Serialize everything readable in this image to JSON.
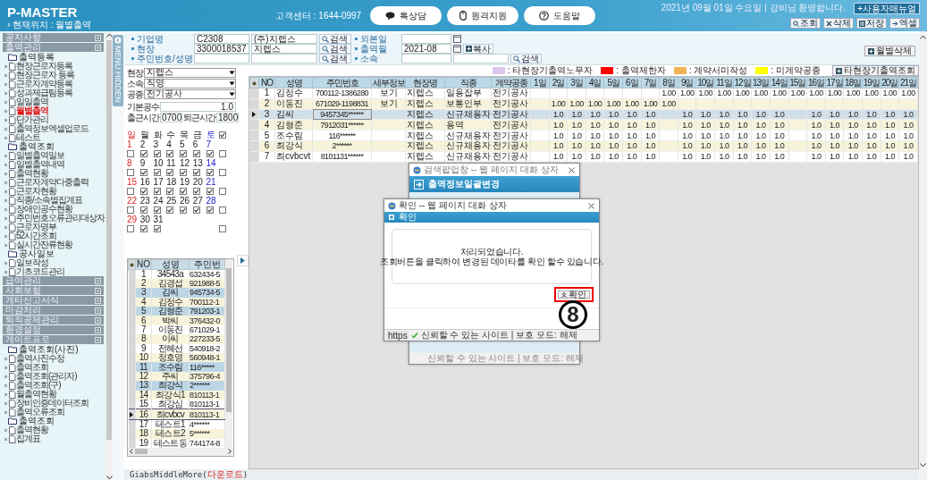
{
  "header": {
    "logo": "P-MASTER",
    "location": "› 현재위치 : 월별출역",
    "support": "고객센터 : 1644-0997",
    "buttons": [
      {
        "label": "톡상담"
      },
      {
        "label": "원격지원"
      },
      {
        "label": "도움말"
      }
    ],
    "date_user": "2021년 09월 01일 수요일 | 강비님 환영합니다.",
    "manual_button": "+사용자매뉴얼",
    "toolbar": [
      {
        "label": "조회"
      },
      {
        "label": "삭제"
      },
      {
        "label": "저장"
      },
      {
        "label": "엑셀"
      }
    ]
  },
  "sidebar": {
    "sections": [
      {
        "label": "공지사항"
      },
      {
        "label": "출역관리",
        "children": [
          {
            "label": "출역등록",
            "children": [
              {
                "label": "현장근로자등록",
                "selected": false
              },
              {
                "label": "현장근로자 등록",
                "selected": false
              },
              {
                "label": "근로자계약등록",
                "selected": false
              },
              {
                "label": "성과제급팀등록",
                "selected": false
              },
              {
                "label": "일일출역",
                "selected": false
              },
              {
                "label": "월별출역",
                "selected": true
              },
              {
                "label": "단가관리",
                "selected": false
              },
              {
                "label": "출역정보엑셀업로드",
                "selected": false
              },
              {
                "label": "테스트",
                "selected": false
              }
            ]
          },
          {
            "label": "출역조회",
            "children": [
              {
                "label": "일별출역일보",
                "selected": false
              },
              {
                "label": "일별출역내역",
                "selected": false
              },
              {
                "label": "출역현황",
                "selected": false
              },
              {
                "label": "근로자계약다중출력",
                "selected": false
              },
              {
                "label": "근로자현황",
                "selected": false
              },
              {
                "label": "직종/소속별집계표",
                "selected": false
              },
              {
                "label": "장애인공수현황",
                "selected": false
              },
              {
                "label": "주민번호오류관리대상자",
                "selected": false
              },
              {
                "label": "근로자명부",
                "selected": false
              },
              {
                "label": "52시간조회",
                "selected": false
              },
              {
                "label": "실시간잔류현황",
                "selected": false
              }
            ]
          },
          {
            "label": "공사일보",
            "children": [
              {
                "label": "일보작성",
                "selected": false
              },
              {
                "label": "기초코드관리",
                "selected": false
              }
            ]
          }
        ]
      },
      {
        "label": "급여관리"
      },
      {
        "label": "사회보험"
      },
      {
        "label": "게타신고서식"
      },
      {
        "label": "마감처리"
      },
      {
        "label": "퇴직공제관리"
      },
      {
        "label": "환경설정"
      },
      {
        "label": "게이트프로",
        "children": [
          {
            "label": "출역조회(사진)",
            "children": [
              {
                "label": "출역사진수정",
                "selected": false
              },
              {
                "label": "출역조회",
                "selected": false
              },
              {
                "label": "출역조회(관리자)",
                "selected": false
              },
              {
                "label": "출역조회(구)",
                "selected": false
              },
              {
                "label": "월출역현황",
                "selected": false
              },
              {
                "label": "장비인증데이터조회",
                "selected": false
              },
              {
                "label": "출역오류조회",
                "selected": false
              }
            ]
          },
          {
            "label": "출역조회",
            "children": [
              {
                "label": "출역현황",
                "selected": false
              },
              {
                "label": "집계표",
                "selected": false
              }
            ]
          }
        ]
      }
    ]
  },
  "menu_toggle": "MENU HIDDEN",
  "filters": {
    "left": [
      {
        "label": "기업명",
        "code": "C2308",
        "name": "(주)지렙스",
        "button": "검색"
      },
      {
        "label": "현장",
        "code": "3300018537",
        "name": "지렙스",
        "button": "검색"
      },
      {
        "label": "주민번호/성명",
        "button": "검색"
      }
    ],
    "right": [
      {
        "label": "외본일",
        "kind": "date"
      },
      {
        "label": "출역월",
        "kind": "date",
        "value": "2021-08",
        "button": "복사"
      },
      {
        "label": "소속",
        "kind": "lookup",
        "button": "검색"
      }
    ]
  },
  "delete_button": "월별삭제",
  "legend": [
    {
      "label": ": 타현장기출역노무자",
      "color": "#dcc6ee"
    },
    {
      "label": ": 출역제한자",
      "color": "#ff0000"
    },
    {
      "label": ": 계약서미작성",
      "color": "#f0b456"
    },
    {
      "label": ": 미계약공종",
      "color": "#ffff00"
    }
  ],
  "legend_button": "타현장기출역조회",
  "options": {
    "selects": [
      {
        "label": "현장",
        "value": "지렙스"
      },
      {
        "label": "소속",
        "value": "직영"
      },
      {
        "label": "공종",
        "value": "전기공사"
      }
    ],
    "base": {
      "label": "기본공수",
      "value": "1.0"
    },
    "times": [
      {
        "label": "출근시간",
        "value": "0700"
      },
      {
        "label": "퇴근시간",
        "value": "1800"
      }
    ]
  },
  "calendar": {
    "weekdays": [
      "일",
      "월",
      "화",
      "수",
      "목",
      "금",
      "토"
    ],
    "all_checked": true,
    "weeks": [
      {
        "checked": false,
        "days": [
          {
            "date": "1",
            "checked": false
          },
          {
            "date": "2",
            "checked": true
          },
          {
            "date": "3",
            "checked": true
          },
          {
            "date": "4",
            "checked": true
          },
          {
            "date": "5",
            "checked": true
          },
          {
            "date": "6",
            "checked": true
          },
          {
            "date": "7",
            "checked": true
          }
        ]
      },
      {
        "checked": false,
        "days": [
          {
            "date": "8",
            "checked": false
          },
          {
            "date": "9",
            "checked": true
          },
          {
            "date": "10",
            "checked": true
          },
          {
            "date": "11",
            "checked": true
          },
          {
            "date": "12",
            "checked": true
          },
          {
            "date": "13",
            "checked": true
          },
          {
            "date": "14",
            "checked": true
          }
        ]
      },
      {
        "checked": false,
        "days": [
          {
            "date": "15",
            "checked": false
          },
          {
            "date": "16",
            "checked": true
          },
          {
            "date": "17",
            "checked": true
          },
          {
            "date": "18",
            "checked": true
          },
          {
            "date": "19",
            "checked": true
          },
          {
            "date": "20",
            "checked": true
          },
          {
            "date": "21",
            "checked": true
          }
        ]
      },
      {
        "checked": false,
        "days": [
          {
            "date": "22",
            "checked": false
          },
          {
            "date": "23",
            "checked": true
          },
          {
            "date": "24",
            "checked": true
          },
          {
            "date": "25",
            "checked": true
          },
          {
            "date": "26",
            "checked": true
          },
          {
            "date": "27",
            "checked": true
          },
          {
            "date": "28",
            "checked": true
          }
        ]
      },
      {
        "checked": false,
        "days": [
          {
            "date": "29",
            "checked": false
          },
          {
            "date": "30",
            "checked": true
          },
          {
            "date": "31",
            "checked": true
          }
        ]
      }
    ]
  },
  "worker_list": {
    "columns": [
      "NO",
      "성명",
      "주민번"
    ],
    "rows": [
      {
        "no": "1",
        "name": "34543a",
        "id": "632434-5",
        "highlighted": false,
        "selected": false
      },
      {
        "no": "2",
        "name": "김경섭",
        "id": "921988-5",
        "highlighted": false,
        "selected": false
      },
      {
        "no": "3",
        "name": "김씨",
        "id": "945734-5",
        "highlighted": true,
        "selected": false
      },
      {
        "no": "4",
        "name": "김정수",
        "id": "700112-1",
        "highlighted": false,
        "selected": false
      },
      {
        "no": "5",
        "name": "김형준",
        "id": "791203-1",
        "highlighted": true,
        "selected": false
      },
      {
        "no": "6",
        "name": "박씨",
        "id": "376432-0",
        "highlighted": false,
        "selected": false
      },
      {
        "no": "7",
        "name": "이동진",
        "id": "671029-1",
        "highlighted": false,
        "selected": false
      },
      {
        "no": "8",
        "name": "이씨",
        "id": "227233-5",
        "highlighted": false,
        "selected": false
      },
      {
        "no": "9",
        "name": "전혜선",
        "id": "540918-2",
        "highlighted": false,
        "selected": false
      },
      {
        "no": "10",
        "name": "정호영",
        "id": "560948-1",
        "highlighted": false,
        "selected": false
      },
      {
        "no": "11",
        "name": "조수림",
        "id": "116*****",
        "highlighted": true,
        "selected": false
      },
      {
        "no": "12",
        "name": "주씨",
        "id": "375796-4",
        "highlighted": false,
        "selected": false
      },
      {
        "no": "13",
        "name": "최강식",
        "id": "2******",
        "highlighted": true,
        "selected": false
      },
      {
        "no": "14",
        "name": "최강식1",
        "id": "810113-1",
        "highlighted": false,
        "selected": false
      },
      {
        "no": "15",
        "name": "최강심",
        "id": "810113-1",
        "highlighted": false,
        "selected": false
      },
      {
        "no": "16",
        "name": "최cvbcv",
        "id": "810113-1",
        "highlighted": false,
        "selected": true
      },
      {
        "no": "17",
        "name": "테스트1",
        "id": "4******",
        "highlighted": false,
        "selected": false
      },
      {
        "no": "18",
        "name": "테스트2",
        "id": "5******",
        "highlighted": false,
        "selected": false
      },
      {
        "no": "19",
        "name": "테스트동",
        "id": "744174-8",
        "highlighted": false,
        "selected": false
      }
    ]
  },
  "table": {
    "columns": [
      "NO",
      "성명",
      "주민번호",
      "세부정보",
      "현장명",
      "직종",
      "계약공종",
      "1일",
      "2일",
      "3일",
      "4일",
      "5일",
      "6일",
      "7일",
      "8일",
      "9일",
      "10일",
      "11일",
      "12일",
      "13일",
      "14일",
      "15일",
      "16일",
      "17일",
      "18일",
      "19일",
      "20일",
      "21일"
    ],
    "rows": [
      {
        "no": "1",
        "name": "김정수",
        "id": "700112-1386280",
        "detail": "보기",
        "site": "지렙스",
        "job": "일용잡부",
        "trade": "전기공사",
        "selected": false,
        "days": [
          {
            "kind": "blank"
          },
          {
            "kind": "blank"
          },
          {
            "kind": "blank"
          },
          {
            "kind": "blank"
          },
          {
            "kind": "blank"
          },
          {
            "kind": "blank"
          },
          {
            "kind": "blank"
          },
          {
            "kind": "value",
            "value": "1.00"
          },
          {
            "kind": "value",
            "value": "1.00"
          },
          {
            "kind": "value",
            "value": "1.00"
          },
          {
            "kind": "value",
            "value": "1.00"
          },
          {
            "kind": "value",
            "value": "1.00"
          },
          {
            "kind": "value",
            "value": "1.00"
          },
          {
            "kind": "value",
            "value": "1.00"
          },
          {
            "kind": "value",
            "value": "1.00"
          },
          {
            "kind": "value",
            "value": "1.00"
          },
          {
            "kind": "value",
            "value": "1.00"
          },
          {
            "kind": "value",
            "value": "1.00"
          },
          {
            "kind": "value",
            "value": "1.00"
          },
          {
            "kind": "value",
            "value": "1.00"
          },
          {
            "kind": "value",
            "value": "1.00"
          }
        ]
      },
      {
        "no": "2",
        "name": "이동진",
        "id": "671029-1198831",
        "detail": "보기",
        "site": "지렙스",
        "job": "보통인부",
        "trade": "전기공사",
        "selected": false,
        "days": [
          {
            "kind": "blank"
          },
          {
            "kind": "value",
            "value": "1.00"
          },
          {
            "kind": "value",
            "value": "1.00"
          },
          {
            "kind": "value",
            "value": "1.00"
          },
          {
            "kind": "value",
            "value": "1.00"
          },
          {
            "kind": "value",
            "value": "1.00"
          },
          {
            "kind": "value",
            "value": "1.00"
          },
          {
            "kind": "value",
            "value": "1.00"
          },
          {
            "kind": "blank"
          },
          {
            "kind": "blank"
          },
          {
            "kind": "blank"
          },
          {
            "kind": "blank"
          },
          {
            "kind": "blank"
          },
          {
            "kind": "blank"
          },
          {
            "kind": "blank"
          },
          {
            "kind": "blank"
          },
          {
            "kind": "blank"
          },
          {
            "kind": "blank"
          },
          {
            "kind": "blank"
          },
          {
            "kind": "blank"
          },
          {
            "kind": "blank"
          }
        ]
      },
      {
        "no": "3",
        "name": "김씨",
        "id": "9457345******",
        "site": "지렙스",
        "job": "신규채용자",
        "trade": "전기공사",
        "selected": true,
        "days": [
          {
            "kind": "blank"
          },
          {
            "kind": "value",
            "value": "1.0"
          },
          {
            "kind": "value",
            "value": "1.0"
          },
          {
            "kind": "value",
            "value": "1.0"
          },
          {
            "kind": "value",
            "value": "1.0"
          },
          {
            "kind": "value",
            "value": "1.0"
          },
          {
            "kind": "value",
            "value": "1.0"
          },
          {
            "kind": "blank"
          },
          {
            "kind": "value",
            "value": "1.0"
          },
          {
            "kind": "value",
            "value": "1.0"
          },
          {
            "kind": "value",
            "value": "1.0"
          },
          {
            "kind": "value",
            "value": "1.0"
          },
          {
            "kind": "value",
            "value": "1.0"
          },
          {
            "kind": "value",
            "value": "1.0"
          },
          {
            "kind": "blank"
          },
          {
            "kind": "value",
            "value": "1.0"
          },
          {
            "kind": "value",
            "value": "1.0"
          },
          {
            "kind": "value",
            "value": "1.0"
          },
          {
            "kind": "value",
            "value": "1.0"
          },
          {
            "kind": "value",
            "value": "1.0"
          },
          {
            "kind": "value",
            "value": "1.0"
          }
        ]
      },
      {
        "no": "4",
        "name": "김형준",
        "id": "7912031******",
        "site": "지렙스",
        "job": "용역",
        "trade": "전기공사",
        "selected": false,
        "days": [
          {
            "kind": "blank"
          },
          {
            "kind": "value",
            "value": "1.0"
          },
          {
            "kind": "value",
            "value": "1.0"
          },
          {
            "kind": "value",
            "value": "1.0"
          },
          {
            "kind": "value",
            "value": "1.0"
          },
          {
            "kind": "value",
            "value": "1.0"
          },
          {
            "kind": "value",
            "value": "1.0"
          },
          {
            "kind": "blank"
          },
          {
            "kind": "value",
            "value": "1.0"
          },
          {
            "kind": "value",
            "value": "1.0"
          },
          {
            "kind": "value",
            "value": "1.0"
          },
          {
            "kind": "value",
            "value": "1.0"
          },
          {
            "kind": "value",
            "value": "1.0"
          },
          {
            "kind": "value",
            "value": "1.0"
          },
          {
            "kind": "blank"
          },
          {
            "kind": "value",
            "value": "1.0"
          },
          {
            "kind": "value",
            "value": "1.0"
          },
          {
            "kind": "value",
            "value": "1.0"
          },
          {
            "kind": "value",
            "value": "1.0"
          },
          {
            "kind": "value",
            "value": "1.0"
          },
          {
            "kind": "value",
            "value": "1.0"
          }
        ]
      },
      {
        "no": "5",
        "name": "조수림",
        "id": "116******",
        "site": "지렙스",
        "job": "신규채용자",
        "trade": "전기공사",
        "selected": false,
        "days": [
          {
            "kind": "blank"
          },
          {
            "kind": "value",
            "value": "1.0"
          },
          {
            "kind": "value",
            "value": "1.0"
          },
          {
            "kind": "value",
            "value": "1.0"
          },
          {
            "kind": "value",
            "value": "1.0"
          },
          {
            "kind": "value",
            "value": "1.0"
          },
          {
            "kind": "value",
            "value": "1.0"
          },
          {
            "kind": "blank"
          },
          {
            "kind": "value",
            "value": "1.0"
          },
          {
            "kind": "value",
            "value": "1.0"
          },
          {
            "kind": "value",
            "value": "1.0"
          },
          {
            "kind": "value",
            "value": "1.0"
          },
          {
            "kind": "value",
            "value": "1.0"
          },
          {
            "kind": "value",
            "value": "1.0"
          },
          {
            "kind": "blank"
          },
          {
            "kind": "value",
            "value": "1.0"
          },
          {
            "kind": "value",
            "value": "1.0"
          },
          {
            "kind": "value",
            "value": "1.0"
          },
          {
            "kind": "value",
            "value": "1.0"
          },
          {
            "kind": "value",
            "value": "1.0"
          },
          {
            "kind": "value",
            "value": "1.0"
          }
        ]
      },
      {
        "no": "6",
        "name": "최강식",
        "id": "2******",
        "site": "지렙스",
        "job": "신규채용자",
        "trade": "전기공사",
        "selected": false,
        "days": [
          {
            "kind": "blank"
          },
          {
            "kind": "value",
            "value": "1.0"
          },
          {
            "kind": "value",
            "value": "1.0"
          },
          {
            "kind": "value",
            "value": "1.0"
          },
          {
            "kind": "value",
            "value": "1.0"
          },
          {
            "kind": "value",
            "value": "1.0"
          },
          {
            "kind": "value",
            "value": "1.0"
          },
          {
            "kind": "blank"
          },
          {
            "kind": "value",
            "value": "1.0"
          },
          {
            "kind": "value",
            "value": "1.0"
          },
          {
            "kind": "value",
            "value": "1.0"
          },
          {
            "kind": "value",
            "value": "1.0"
          },
          {
            "kind": "value",
            "value": "1.0"
          },
          {
            "kind": "value",
            "value": "1.0"
          },
          {
            "kind": "blank"
          },
          {
            "kind": "value",
            "value": "1.0"
          },
          {
            "kind": "value",
            "value": "1.0"
          },
          {
            "kind": "value",
            "value": "1.0"
          },
          {
            "kind": "value",
            "value": "1.0"
          },
          {
            "kind": "value",
            "value": "1.0"
          },
          {
            "kind": "value",
            "value": "1.0"
          }
        ]
      },
      {
        "no": "7",
        "name": "최cvbcvt",
        "id": "8101131******",
        "site": "지렙스",
        "job": "신규채용자",
        "trade": "전기공사",
        "selected": false,
        "days": [
          {
            "kind": "blank"
          },
          {
            "kind": "value",
            "value": "1.0"
          },
          {
            "kind": "value",
            "value": "1.0"
          },
          {
            "kind": "value",
            "value": "1.0"
          },
          {
            "kind": "value",
            "value": "1.0"
          },
          {
            "kind": "value",
            "value": "1.0"
          },
          {
            "kind": "value",
            "value": "1.0"
          },
          {
            "kind": "blank"
          },
          {
            "kind": "value",
            "value": "1.0"
          },
          {
            "kind": "value",
            "value": "1.0"
          },
          {
            "kind": "value",
            "value": "1.0"
          },
          {
            "kind": "value",
            "value": "1.0"
          },
          {
            "kind": "value",
            "value": "1.0"
          },
          {
            "kind": "value",
            "value": "1.0"
          },
          {
            "kind": "blank"
          },
          {
            "kind": "value",
            "value": "1.0"
          },
          {
            "kind": "value",
            "value": "1.0"
          },
          {
            "kind": "value",
            "value": "1.0"
          },
          {
            "kind": "value",
            "value": "1.0"
          },
          {
            "kind": "value",
            "value": "1.0"
          },
          {
            "kind": "value",
            "value": "1.0"
          }
        ]
      }
    ]
  },
  "dialogs": [
    {
      "title": "검색팝업창 -- 웹 페이지 대화 상자",
      "heading": "출역정보일괄변경"
    },
    {
      "title": "확인 -- 웹 페이지 대화 상자",
      "heading": "확인",
      "message": [
        "처리되었습니다.",
        "조회버튼을 클릭하여 변경된 데이타를 확인 할수 있습니다."
      ],
      "button": "확인",
      "button_highlighted": true,
      "protocol": "https",
      "status": "신뢰할 수 있는 사이트 | 보호 모드: 해제"
    }
  ],
  "annotation": {
    "label": "8"
  },
  "back_dialog_status": "신뢰할 수 있는 사이트 | 보호 모드: 해제",
  "footer": {
    "prefix": "GiabsMiddleMore(",
    "link": "다운로드",
    "suffix": ")"
  }
}
